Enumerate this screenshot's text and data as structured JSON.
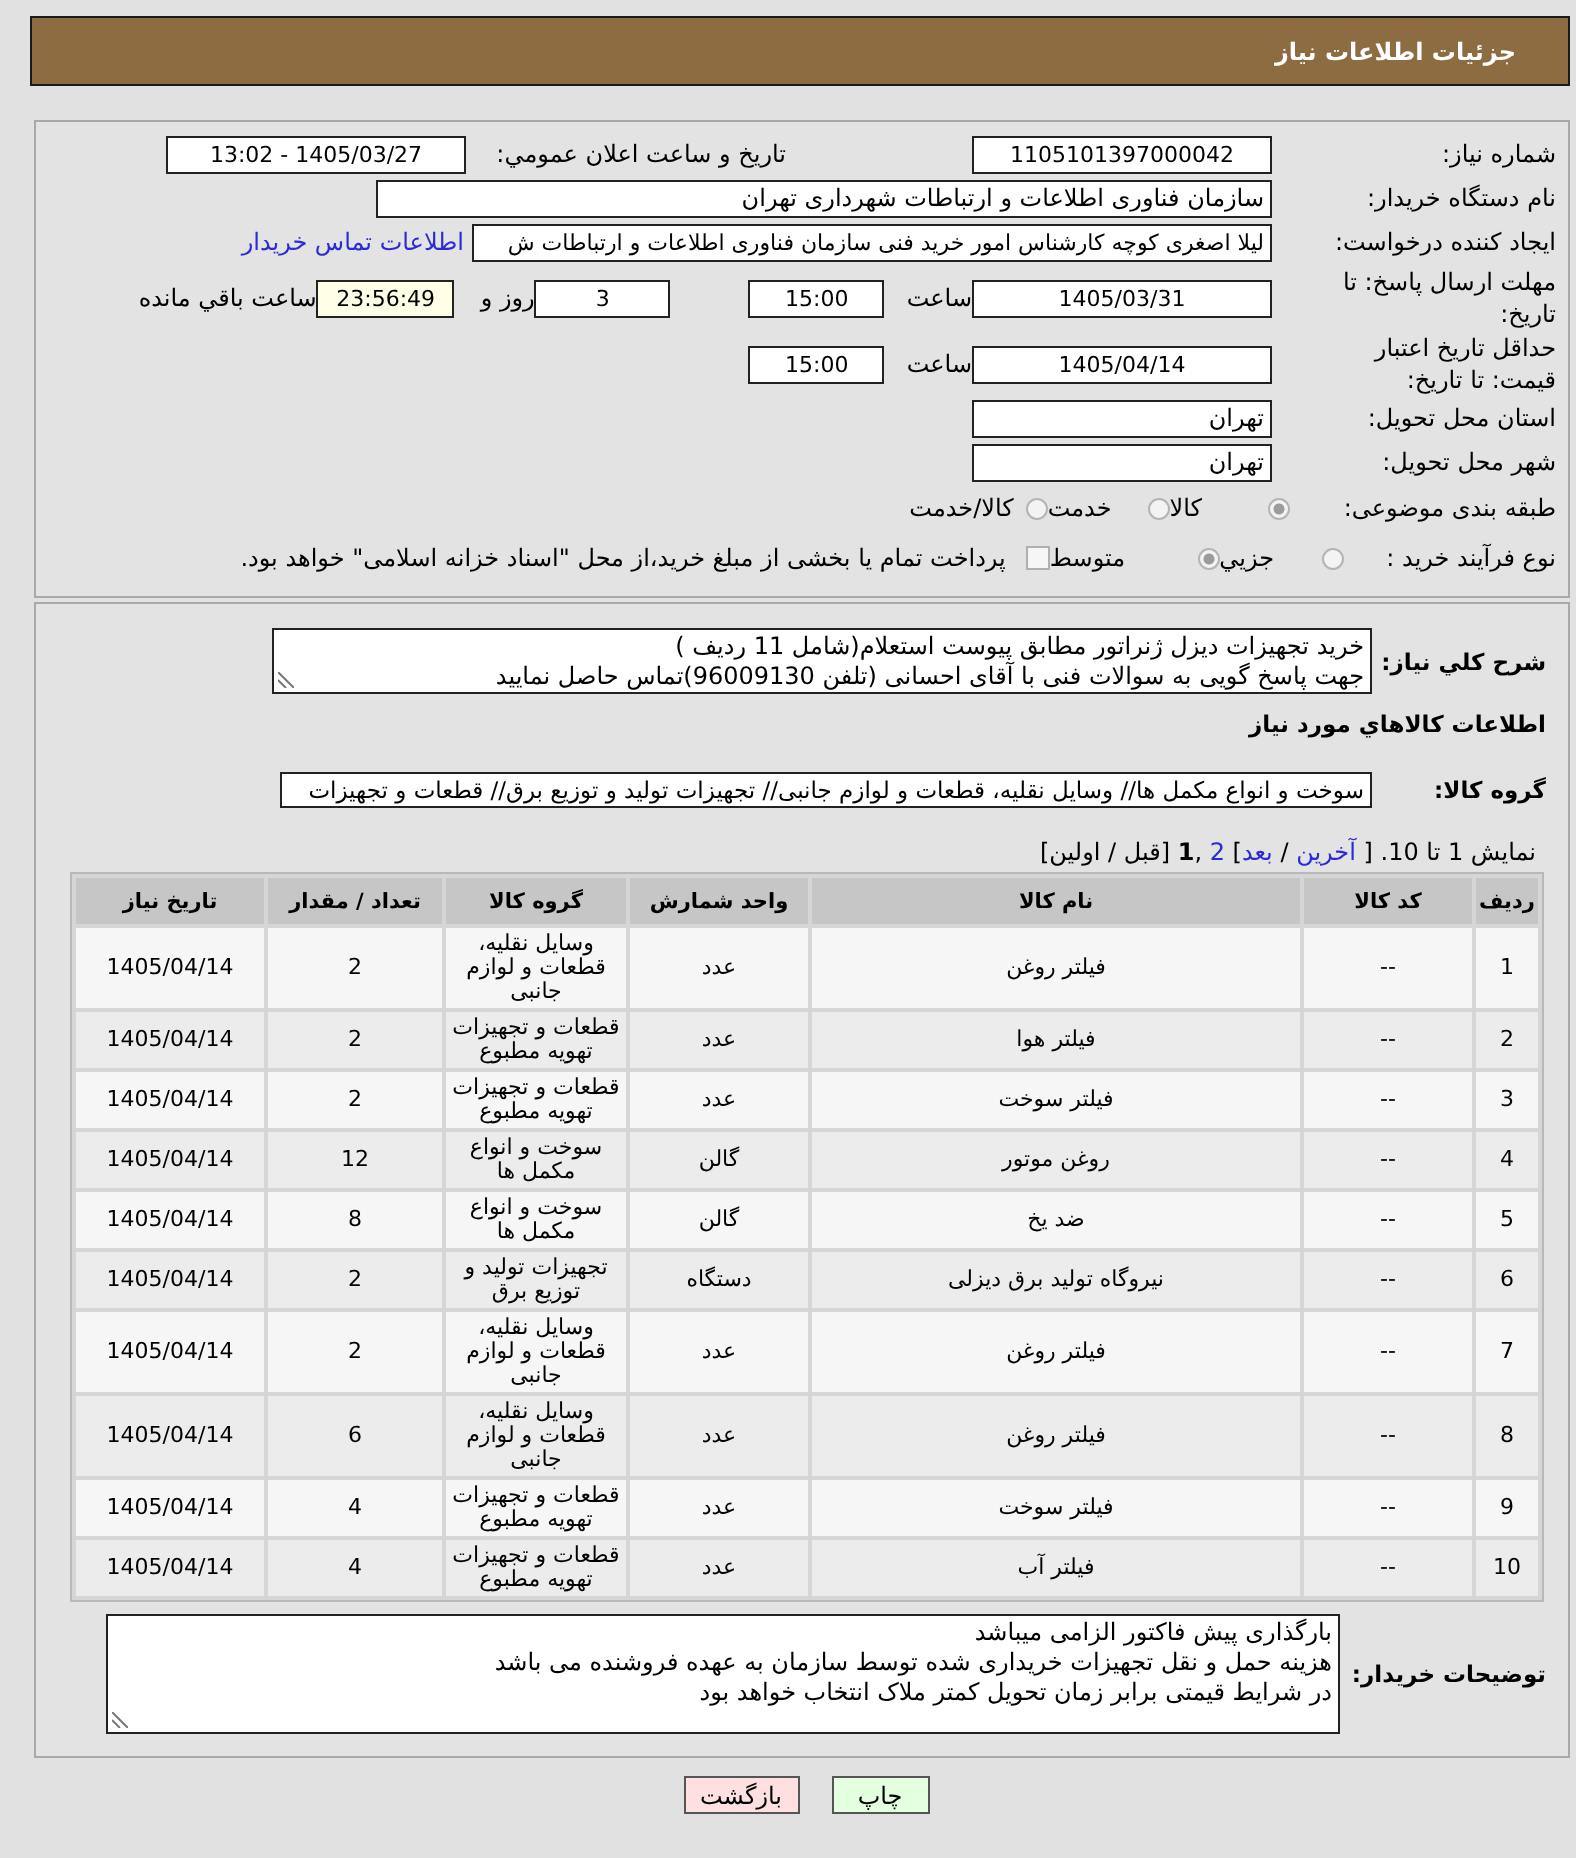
{
  "header": {
    "title": "جزئیات اطلاعات نیاز"
  },
  "details": {
    "need_number": {
      "label": "شماره نیاز:",
      "value": "1105101397000042"
    },
    "announcement": {
      "label": "تاریخ و ساعت اعلان عمومي:",
      "value": "1405/03/27 - 13:02"
    },
    "buyer_org": {
      "label": "نام دستگاه خريدار:",
      "value": "سازمان فناوری اطلاعات و ارتباطات شهرداری تهران"
    },
    "requester": {
      "label": "ايجاد كننده درخواست:",
      "value": "ليلا اصغری کوچه کارشناس امور خرید فنی سازمان فناوری اطلاعات و ارتباطات ش",
      "contact_link": "اطلاعات تماس خريدار"
    },
    "reply_deadline": {
      "label": "مهلت ارسال پاسخ: تا تاریخ:",
      "date": "1405/03/31",
      "time_label": "ساعت",
      "time": "15:00",
      "days": "3",
      "days_label": "روز و",
      "remaining": "23:56:49",
      "remaining_label": "ساعت باقي مانده"
    },
    "price_validity": {
      "label": "حداقل تاریخ اعتبار قیمت: تا تاریخ:",
      "date": "1405/04/14",
      "time_label": "ساعت",
      "time": "15:00"
    },
    "delivery_province": {
      "label": "استان محل تحویل:",
      "value": "تهران"
    },
    "delivery_city": {
      "label": "شهر محل تحویل:",
      "value": "تهران"
    },
    "category": {
      "label": "طبقه بندی موضوعی:",
      "options": [
        {
          "label": "کالا",
          "selected": true
        },
        {
          "label": "خدمت",
          "selected": false
        },
        {
          "label": "کالا/خدمت",
          "selected": false
        }
      ]
    },
    "process": {
      "label": "نوع فرآیند خرید :",
      "options": [
        {
          "label": "جزيي",
          "selected": false
        },
        {
          "label": "متوسط",
          "selected": true
        }
      ],
      "treasury": {
        "label": "پرداخت تمام یا بخشی از مبلغ خرید،از محل \"اسناد خزانه اسلامی\" خواهد بود.",
        "checked": false
      }
    }
  },
  "description": {
    "label": "شرح کلي نياز:",
    "lines": [
      "خرید تجهیزات دیزل ژنراتور مطابق پیوست استعلام(شامل 11 ردیف )",
      "جهت پاسخ گویی به سوالات فنی با آقای احسانی (تلفن 96009130)تماس حاصل نمایید"
    ]
  },
  "goods": {
    "title": "اطلاعات کالاهاي مورد نياز",
    "group_label": "گروه کالا:",
    "group_value": "سوخت و انواع مکمل ها// وسایل نقلیه، قطعات و لوازم جانبی// تجهیزات تولید و توزیع برق//  قطعات و تجهیزات",
    "pagination": [
      {
        "kind": "text",
        "text": "نمایش 1 تا 10. [ "
      },
      {
        "kind": "link",
        "text": "آخرین"
      },
      {
        "kind": "text",
        "text": " / "
      },
      {
        "kind": "link",
        "text": "بعد"
      },
      {
        "kind": "text",
        "text": "] "
      },
      {
        "kind": "link",
        "text": "2"
      },
      {
        "kind": "text",
        "text": " ,"
      },
      {
        "kind": "current",
        "text": "1"
      },
      {
        "kind": "text",
        "text": " [قبل / اولین]"
      }
    ],
    "table": {
      "columns": [
        "ردیف",
        "کد کالا",
        "نام کالا",
        "واحد شمارش",
        "گروه کالا",
        "تعداد / مقدار",
        "تاریخ نیاز"
      ],
      "rows": [
        {
          "index": "1",
          "code": "--",
          "name": "فیلتر روغن",
          "unit": "عدد",
          "group": "وسایل نقلیه، قطعات و لوازم جانبی",
          "quantity": "2",
          "date": "1405/04/14"
        },
        {
          "index": "2",
          "code": "--",
          "name": "فیلتر هوا",
          "unit": "عدد",
          "group": "قطعات و تجهیزات تهویه مطبوع",
          "quantity": "2",
          "date": "1405/04/14"
        },
        {
          "index": "3",
          "code": "--",
          "name": "فیلتر سوخت",
          "unit": "عدد",
          "group": "قطعات و تجهیزات تهویه مطبوع",
          "quantity": "2",
          "date": "1405/04/14"
        },
        {
          "index": "4",
          "code": "--",
          "name": "روغن موتور",
          "unit": "گالن",
          "group": "سوخت و انواع مکمل ها",
          "quantity": "12",
          "date": "1405/04/14"
        },
        {
          "index": "5",
          "code": "--",
          "name": "ضد یخ",
          "unit": "گالن",
          "group": "سوخت و انواع مکمل ها",
          "quantity": "8",
          "date": "1405/04/14"
        },
        {
          "index": "6",
          "code": "--",
          "name": "نیروگاه تولید برق دیزلی",
          "unit": "دستگاه",
          "group": "تجهیزات تولید و توزیع برق",
          "quantity": "2",
          "date": "1405/04/14"
        },
        {
          "index": "7",
          "code": "--",
          "name": "فیلتر روغن",
          "unit": "عدد",
          "group": "وسایل نقلیه، قطعات و لوازم جانبی",
          "quantity": "2",
          "date": "1405/04/14"
        },
        {
          "index": "8",
          "code": "--",
          "name": "فیلتر روغن",
          "unit": "عدد",
          "group": "وسایل نقلیه، قطعات و لوازم جانبی",
          "quantity": "6",
          "date": "1405/04/14"
        },
        {
          "index": "9",
          "code": "--",
          "name": "فیلتر سوخت",
          "unit": "عدد",
          "group": "قطعات و تجهیزات تهویه مطبوع",
          "quantity": "4",
          "date": "1405/04/14"
        },
        {
          "index": "10",
          "code": "--",
          "name": "فیلتر آب",
          "unit": "عدد",
          "group": "قطعات و تجهیزات تهویه مطبوع",
          "quantity": "4",
          "date": "1405/04/14"
        }
      ]
    }
  },
  "buyer_notes": {
    "label": "توضیحات خریدار:",
    "lines": [
      "بارگذاری پیش فاکتور الزامی میباشد",
      "هزینه حمل و نقل تجهیزات خریداری شده توسط سازمان به عهده فروشنده می باشد",
      "در شرایط قیمتی برابر زمان تحویل کمتر ملاک انتخاب خواهد بود"
    ]
  },
  "buttons": [
    {
      "kind": "print",
      "label": "چاپ"
    },
    {
      "kind": "back",
      "label": "بازگشت"
    }
  ]
}
